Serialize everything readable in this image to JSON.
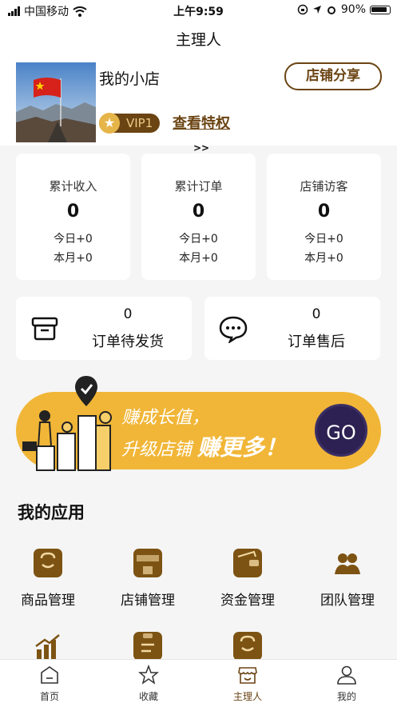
{
  "status_bar": {
    "carrier": "中国移动",
    "time": "上午9:59",
    "battery": "90%"
  },
  "nav": {
    "title": "主理人"
  },
  "shop": {
    "name": "我的小店",
    "vip": "VIP1",
    "privilege_link": "查看特权",
    "arrows": ">>",
    "share_button": "店铺分享"
  },
  "stats": [
    {
      "title": "累计收入",
      "value": "0",
      "today": "今日+0",
      "month": "本月+0"
    },
    {
      "title": "累计订单",
      "value": "0",
      "today": "今日+0",
      "month": "本月+0"
    },
    {
      "title": "店铺访客",
      "value": "0",
      "today": "今日+0",
      "month": "本月+0"
    }
  ],
  "orders": [
    {
      "count": "0",
      "label": "订单待发货",
      "icon": "box-icon"
    },
    {
      "count": "0",
      "label": "订单售后",
      "icon": "chat-bubble-icon"
    }
  ],
  "banner": {
    "line1": "赚成长值，",
    "line2a": "升级店铺",
    "line2b": "赚更多！",
    "go": "GO"
  },
  "apps": {
    "title": "我的应用",
    "items": [
      {
        "label": "商品管理",
        "icon": "shopping-bag-icon"
      },
      {
        "label": "店铺管理",
        "icon": "storefront-icon"
      },
      {
        "label": "资金管理",
        "icon": "wallet-icon"
      },
      {
        "label": "团队管理",
        "icon": "team-icon"
      },
      {
        "label": "",
        "icon": "bar-chart-icon"
      },
      {
        "label": "",
        "icon": "clipboard-icon"
      },
      {
        "label": "",
        "icon": "shopping-bag-icon"
      }
    ]
  },
  "tabbar": [
    {
      "label": "首页",
      "icon": "home-icon"
    },
    {
      "label": "收藏",
      "icon": "star-icon"
    },
    {
      "label": "主理人",
      "icon": "store-icon"
    },
    {
      "label": "我的",
      "icon": "user-icon"
    }
  ],
  "colors": {
    "accent": "#6b4413",
    "banner": "#f1b637",
    "go_button": "#2c2152"
  }
}
